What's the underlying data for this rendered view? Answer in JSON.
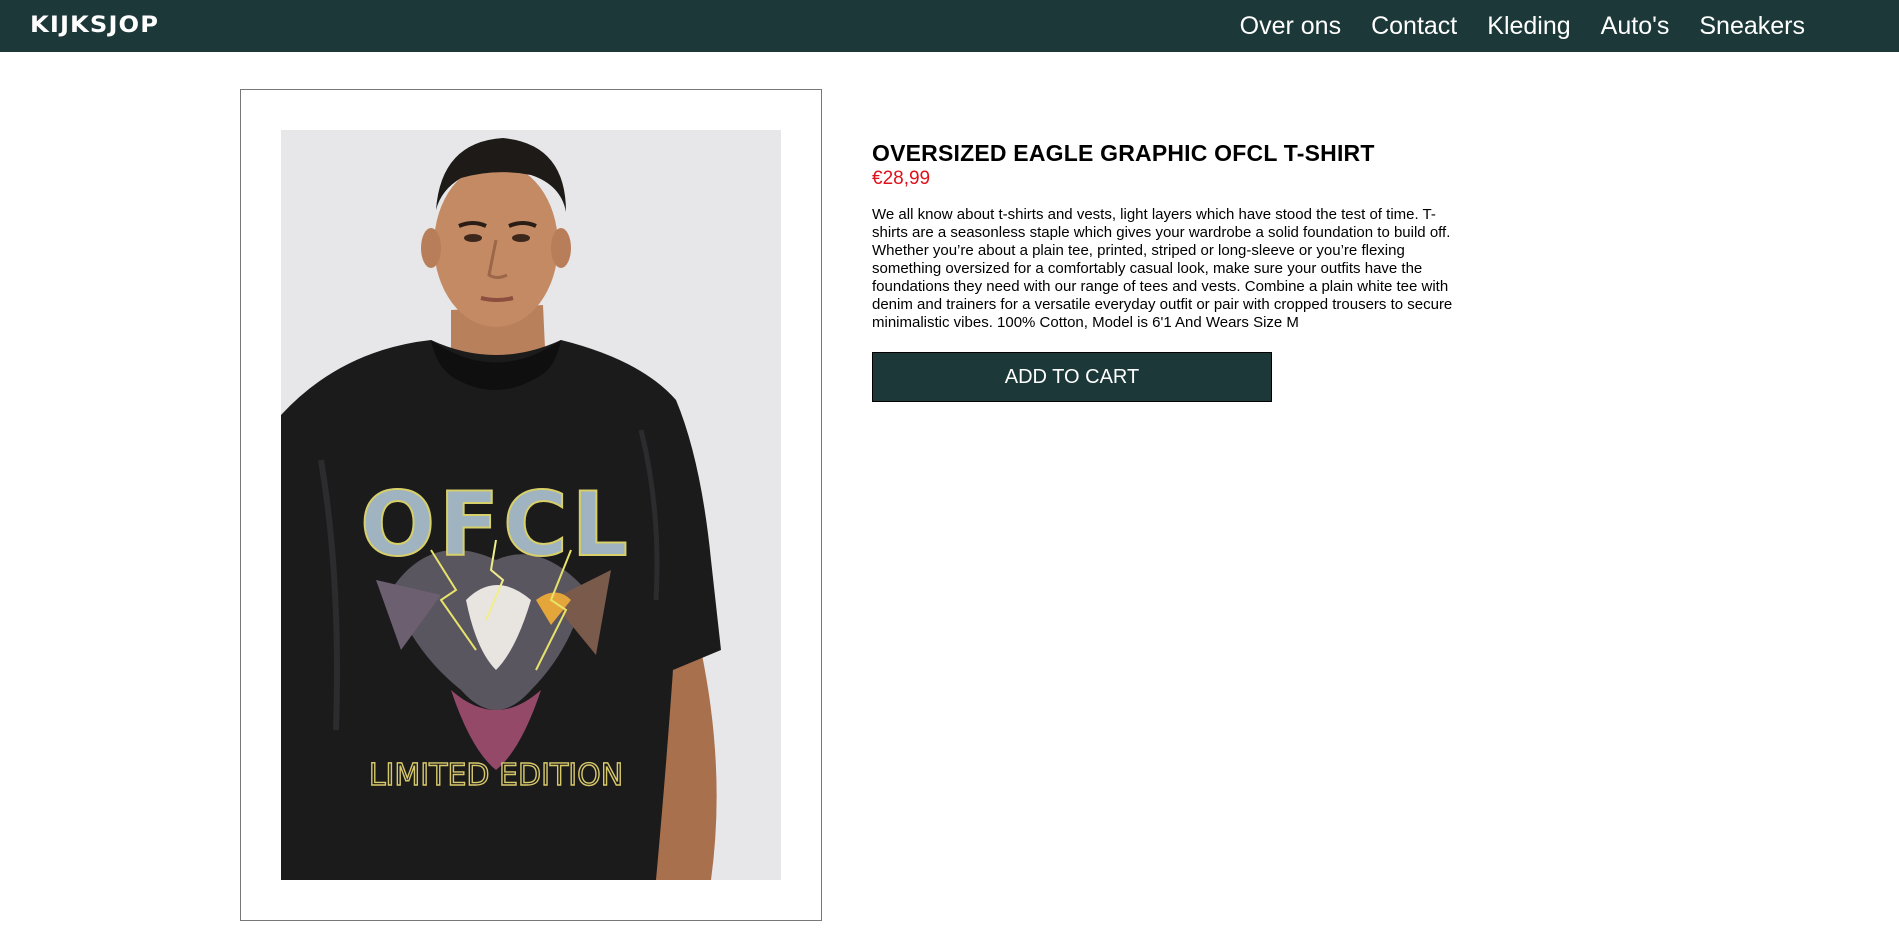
{
  "header": {
    "logo": "KIJKSJOP",
    "nav": [
      {
        "label": "Over ons"
      },
      {
        "label": "Contact"
      },
      {
        "label": "Kleding"
      },
      {
        "label": "Auto's"
      },
      {
        "label": "Sneakers"
      }
    ]
  },
  "product": {
    "title": "OVERSIZED EAGLE GRAPHIC OFCL T-SHIRT",
    "price": "€28,99",
    "description": "We all know about t-shirts and vests, light layers which have stood the test of time. T-shirts are a seasonless staple which gives your wardrobe a solid foundation to build off. Whether you’re about a plain tee, printed, striped or long-sleeve or you’re flexing something oversized for a comfortably casual look, make sure your outfits have the foundations they need with our range of tees and vests. Combine a plain white tee with denim and trainers for a versatile everyday outfit or pair with cropped trousers to secure minimalistic vibes. 100% Cotton, Model is 6'1 And Wears Size M",
    "cart_label": "ADD TO CART",
    "image": {
      "shirt_print_text": "OFCL",
      "shirt_print_subtext": "LIMITED EDITION"
    }
  },
  "colors": {
    "header_bg": "#1c3838",
    "price": "#e0111b",
    "button_bg": "#1c3838"
  }
}
